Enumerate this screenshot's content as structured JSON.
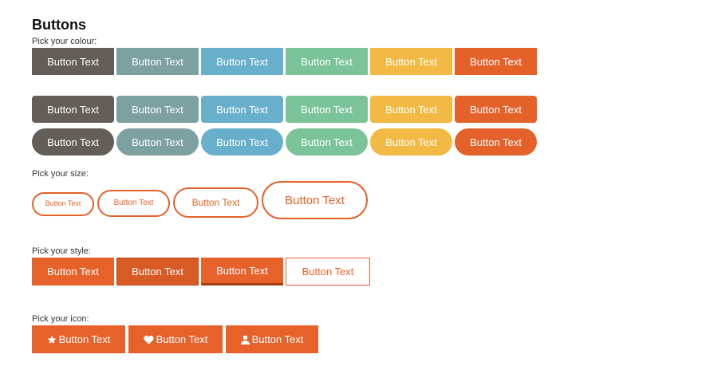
{
  "title": "Buttons",
  "colour": {
    "label": "Pick your colour:",
    "button_text": "Button Text",
    "colors": [
      "#635e58",
      "#7da0a0",
      "#67afcb",
      "#7bc49a",
      "#f2b944",
      "#e4622a"
    ]
  },
  "size": {
    "label": "Pick your size:",
    "button_text": "Button Text",
    "color": "#e4622a"
  },
  "style": {
    "label": "Pick your style:",
    "button_text": "Button Text",
    "color": "#e7612a"
  },
  "icon": {
    "label": "Pick your icon:",
    "color": "#e7612a",
    "buttons": [
      {
        "icon": "star-icon",
        "text": "Button Text"
      },
      {
        "icon": "heart-icon",
        "text": "Button Text"
      },
      {
        "icon": "user-icon",
        "text": "Button Text"
      }
    ]
  }
}
